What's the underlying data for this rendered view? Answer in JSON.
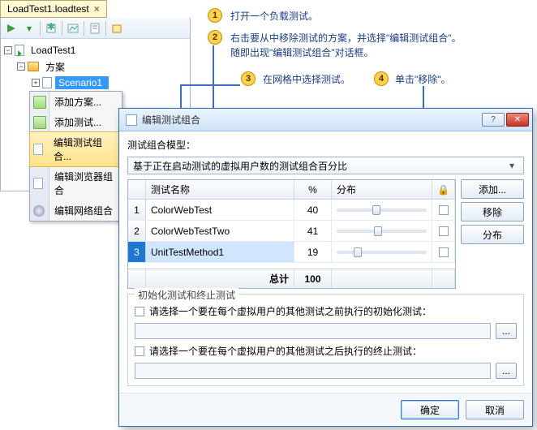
{
  "tab": {
    "title": "LoadTest1.loadtest"
  },
  "tree": {
    "root": "LoadTest1",
    "folder": "方案",
    "scenario": "Scenario1"
  },
  "ctx": {
    "add_scenario": "添加方案...",
    "add_test": "添加测试...",
    "edit_test_mix": "编辑测试组合...",
    "edit_browser_mix": "编辑浏览器组合",
    "edit_network_mix": "编辑网络组合"
  },
  "callouts": {
    "n1": "1",
    "t1": "打开一个负载测试。",
    "n2": "2",
    "t2a": "右击要从中移除测试的方案，并选择\"编辑测试组合\"。",
    "t2b": "随即出现\"编辑测试组合\"对话框。",
    "n3": "3",
    "t3": "在网格中选择测试。",
    "n4": "4",
    "t4": "单击\"移除\"。"
  },
  "dialog": {
    "title": "编辑测试组合",
    "model_label": "测试组合模型：",
    "model_value": "基于正在启动测试的虚拟用户数的测试组合百分比",
    "headers": {
      "name": "测试名称",
      "pct": "%",
      "dist": "分布",
      "lock": "🔒"
    },
    "rows": [
      {
        "n": "1",
        "name": "ColorWebTest",
        "pct": "40",
        "thumb": 40
      },
      {
        "n": "2",
        "name": "ColorWebTestTwo",
        "pct": "41",
        "thumb": 41
      },
      {
        "n": "3",
        "name": "UnitTestMethod1",
        "pct": "19",
        "thumb": 19
      }
    ],
    "total_label": "总计",
    "total_value": "100",
    "btn_add": "添加...",
    "btn_remove": "移除",
    "btn_dist": "分布",
    "group_title": "初始化测试和终止测试",
    "init_label": "请选择一个要在每个虚拟用户的其他测试之前执行的初始化测试：",
    "term_label": "请选择一个要在每个虚拟用户的其他测试之后执行的终止测试：",
    "ellipsis": "...",
    "ok": "确定",
    "cancel": "取消"
  }
}
